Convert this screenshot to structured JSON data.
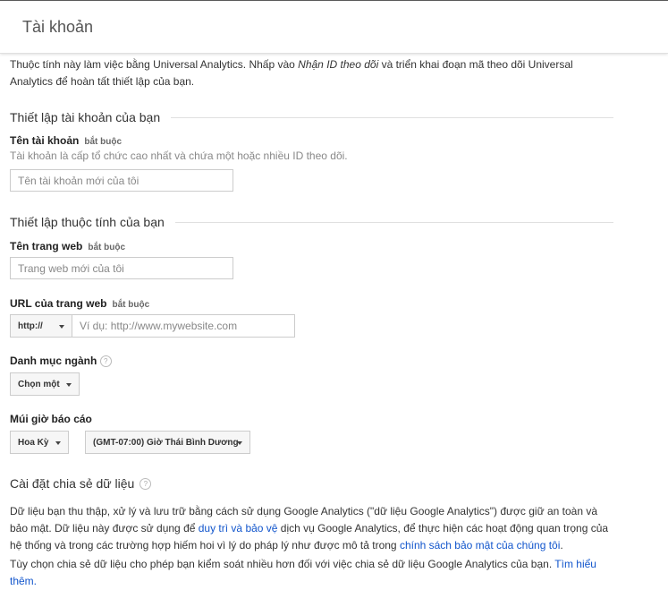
{
  "header": {
    "title": "Tài khoản"
  },
  "intro": {
    "text_before": "Thuộc tính này làm việc bằng Universal Analytics. Nhấp vào ",
    "text_italic": "Nhận ID theo dõi",
    "text_after": " và triển khai đoạn mã theo dõi Universal Analytics để hoàn tất thiết lập của bạn."
  },
  "account_section": {
    "heading": "Thiết lập tài khoản của bạn",
    "name_label": "Tên tài khoản",
    "required_label": "bắt buộc",
    "name_description": "Tài khoản là cấp tổ chức cao nhất và chứa một hoặc nhiều ID theo dõi.",
    "name_placeholder": "Tên tài khoản mới của tôi"
  },
  "property_section": {
    "heading": "Thiết lập thuộc tính của bạn",
    "website_name_label": "Tên trang web",
    "website_name_placeholder": "Trang web mới của tôi",
    "url_label": "URL của trang web",
    "protocol_value": "http://",
    "url_placeholder": "Ví dụ: http://www.mywebsite.com",
    "industry_label": "Danh mục ngành",
    "industry_value": "Chọn một",
    "timezone_label": "Múi giờ báo cáo",
    "country_value": "Hoa Kỳ",
    "timezone_value": "(GMT-07:00) Giờ Thái Bình Dương",
    "required_label": "bắt buộc",
    "help_glyph": "?"
  },
  "sharing_section": {
    "heading": "Cài đặt chia sẻ dữ liệu",
    "p1_a": "Dữ liệu bạn thu thập, xử lý và lưu trữ bằng cách sử dụng Google Analytics (\"dữ liệu Google Analytics\") được giữ an toàn và bảo mật. Dữ liệu này được sử dụng để ",
    "p1_link1": "duy trì và bảo vệ",
    "p1_b": " dịch vụ Google Analytics, để thực hiện các hoạt động quan trọng của hệ thống và trong các trường hợp hiếm hoi vì lý do pháp lý như được mô tả trong ",
    "p1_link2": "chính sách bảo mật của chúng tôi",
    "p1_c": ".",
    "p2_a": "Tùy chọn chia sẻ dữ liệu cho phép bạn kiểm soát nhiều hơn đối với việc chia sẻ dữ liệu Google Analytics của bạn. ",
    "p2_link": "Tìm hiểu thêm."
  },
  "colors": {
    "link": "#1155cc",
    "border": "#cccccc",
    "text": "#333333"
  }
}
